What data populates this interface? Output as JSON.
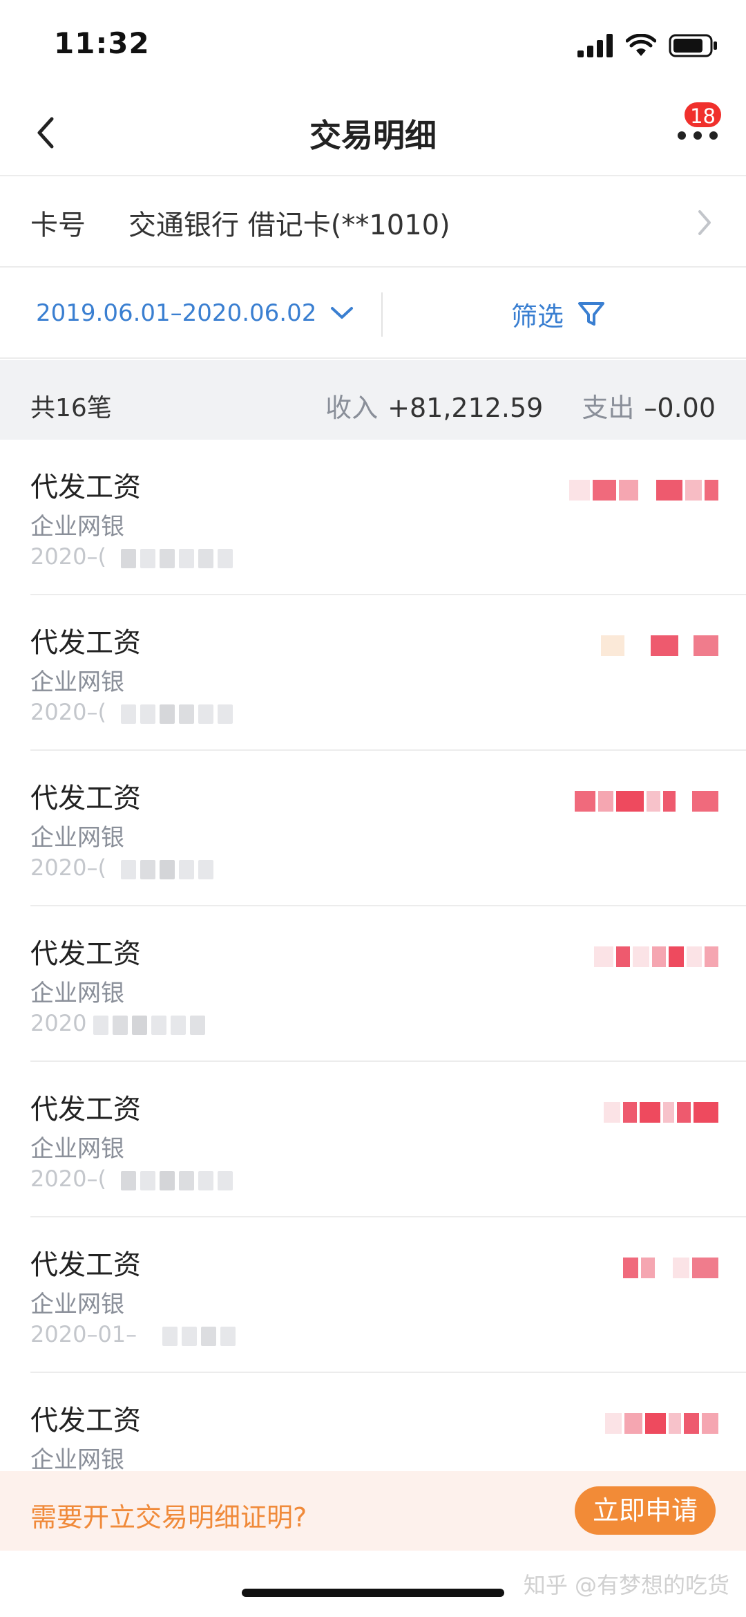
{
  "status_bar": {
    "time": "11:32"
  },
  "nav": {
    "title": "交易明细",
    "badge_count": "18"
  },
  "card": {
    "label": "卡号",
    "value": "交通银行 借记卡(**1010)"
  },
  "filter": {
    "date_range": "2019.06.01–2020.06.02",
    "filter_label": "筛选"
  },
  "summary": {
    "count": "共16笔",
    "income_label": "收入",
    "income_value": "+81,212.59",
    "expense_label": "支出",
    "expense_value": "–0.00"
  },
  "transactions": [
    {
      "title": "代发工资",
      "channel": "企业网银",
      "date_prefix": "2020–("
    },
    {
      "title": "代发工资",
      "channel": "企业网银",
      "date_prefix": "2020–("
    },
    {
      "title": "代发工资",
      "channel": "企业网银",
      "date_prefix": "2020–("
    },
    {
      "title": "代发工资",
      "channel": "企业网银",
      "date_prefix": "2020"
    },
    {
      "title": "代发工资",
      "channel": "企业网银",
      "date_prefix": "2020–("
    },
    {
      "title": "代发工资",
      "channel": "企业网银",
      "date_prefix": "2020–01–"
    },
    {
      "title": "代发工资",
      "channel": "企业网银",
      "date_prefix": ""
    }
  ],
  "promo": {
    "text": "需要开立交易明细证明?",
    "button": "立即申请"
  },
  "watermark": "知乎 @有梦想的吃货",
  "colors": {
    "accent_blue": "#3a7fd1",
    "accent_orange": "#f28b37",
    "badge_red": "#f0302c"
  }
}
